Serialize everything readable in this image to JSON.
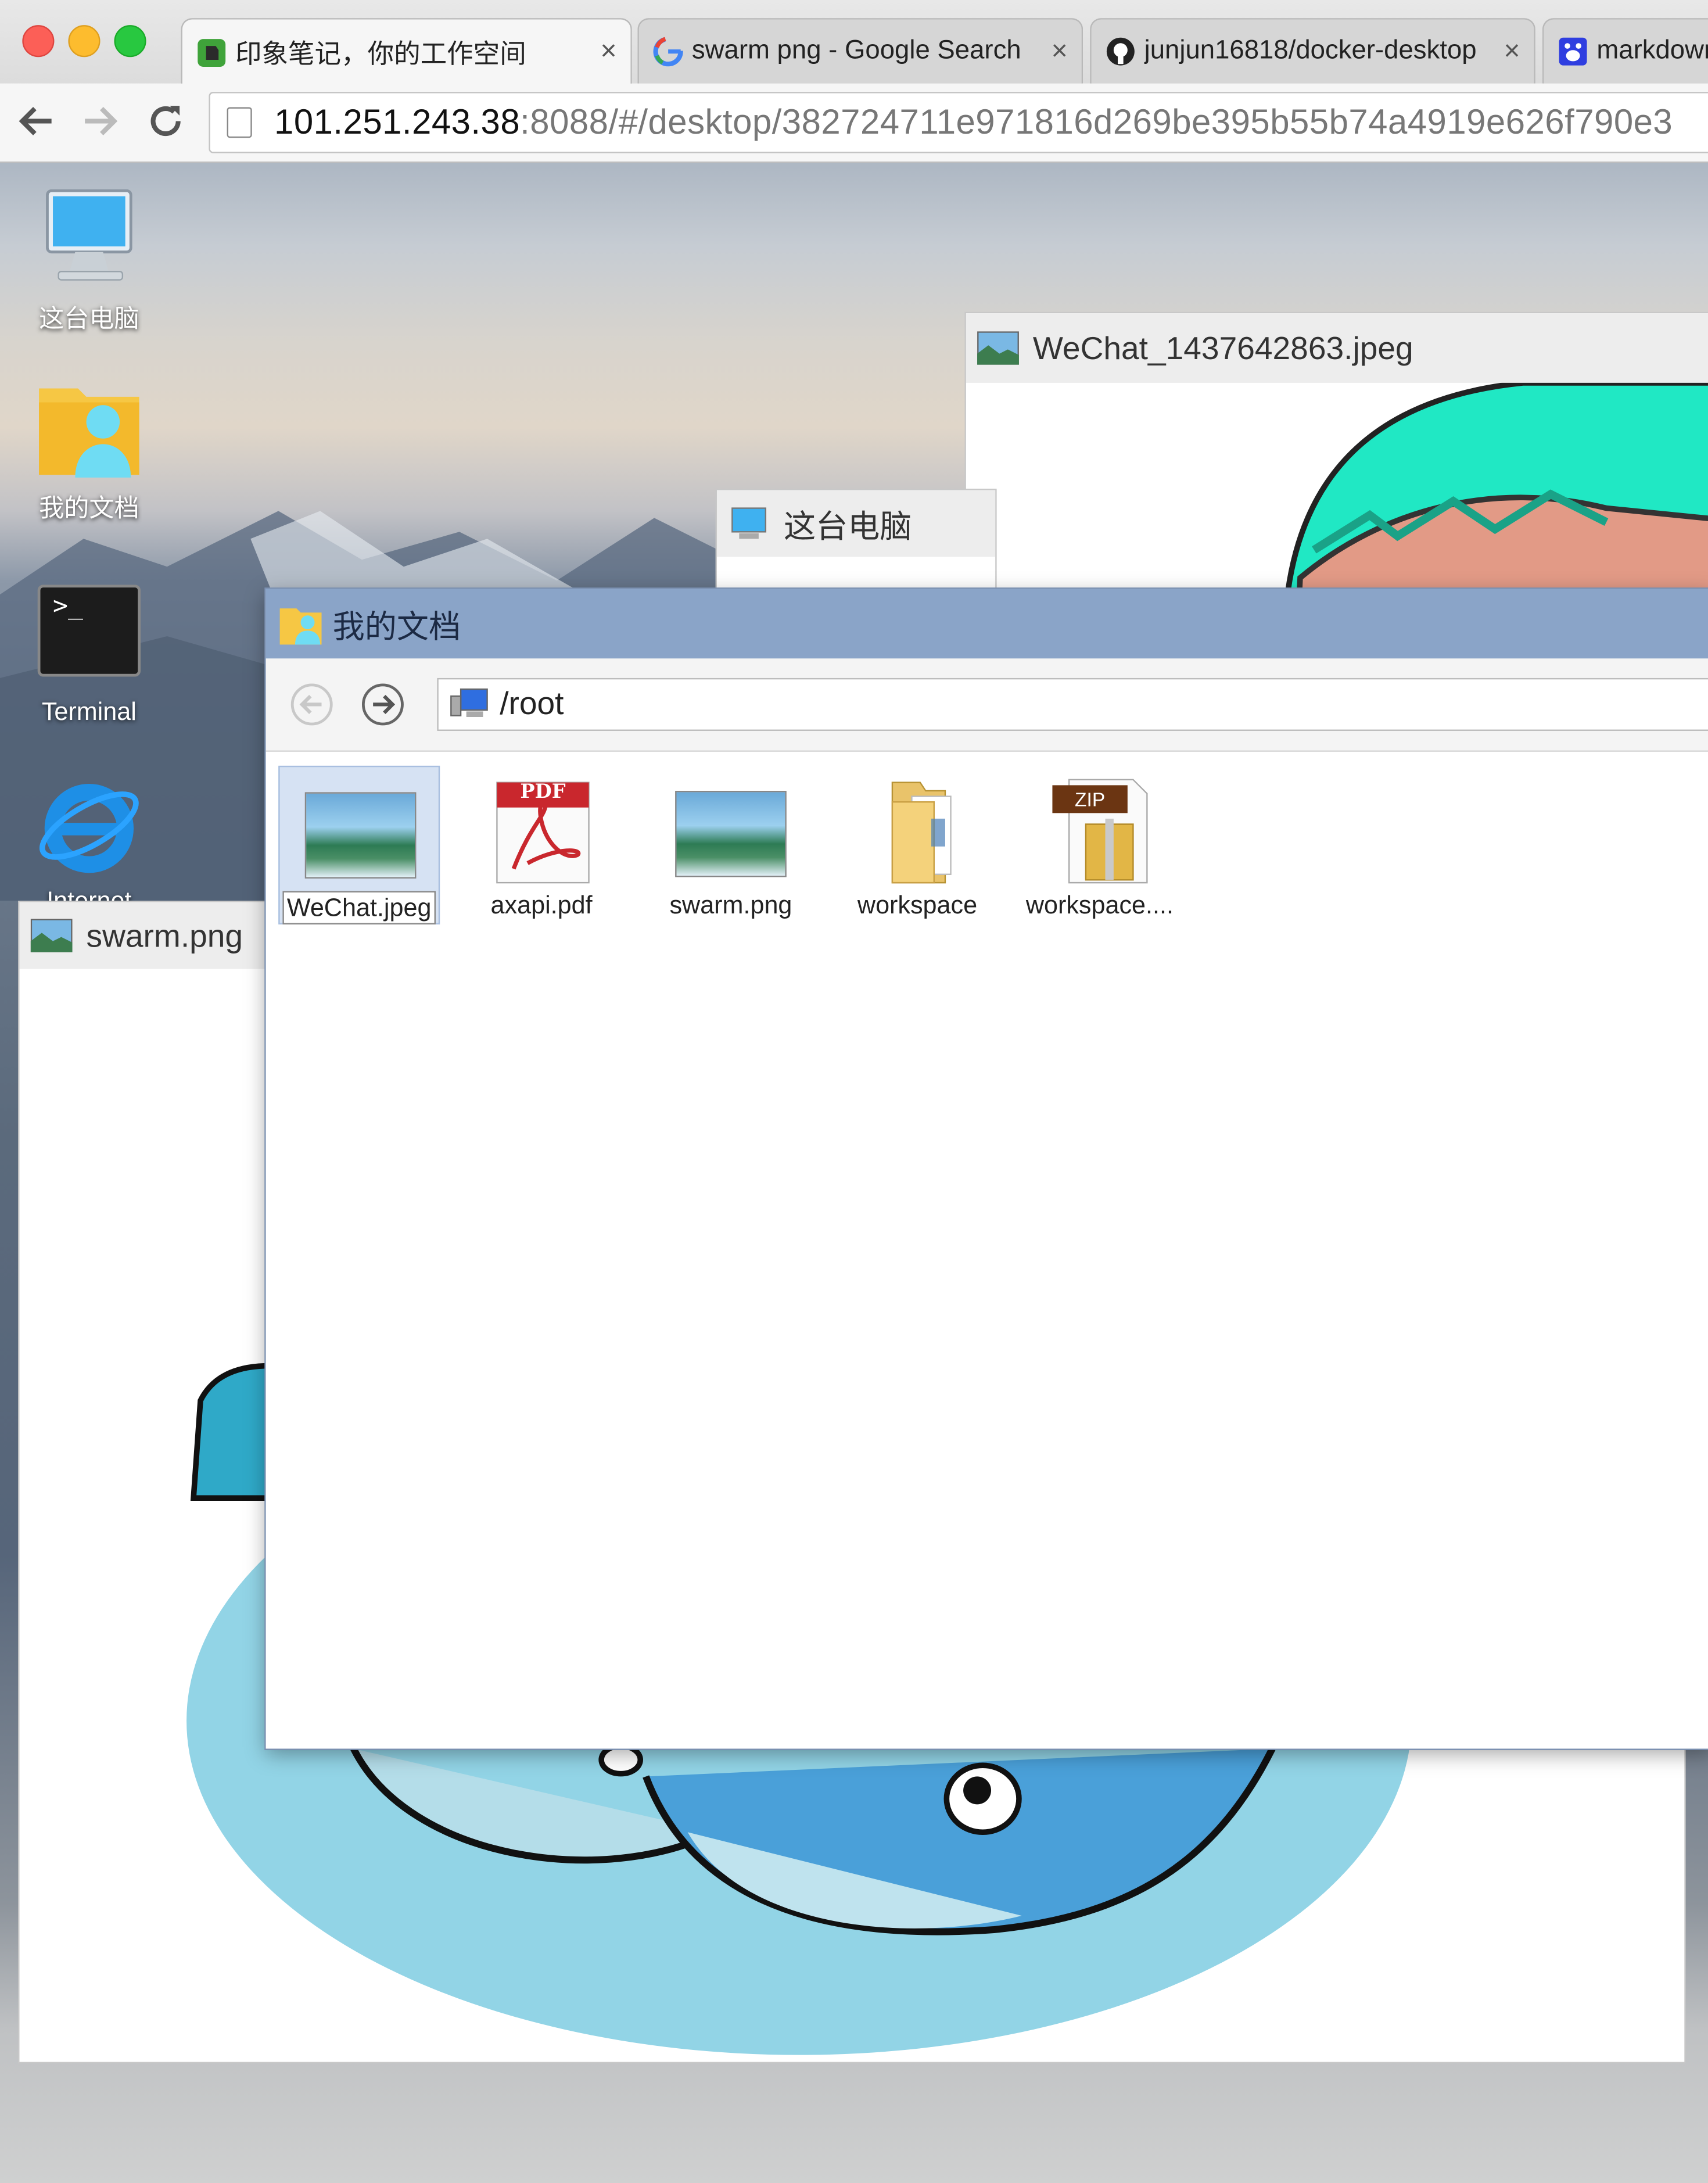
{
  "browser": {
    "tabs": [
      {
        "title": "印象笔记，你的工作空间",
        "icon": "evernote-icon",
        "active": true
      },
      {
        "title": "swarm png - Google Search",
        "icon": "google-icon",
        "active": false
      },
      {
        "title": "junjun16818/docker-desktop",
        "icon": "github-icon",
        "active": false
      },
      {
        "title": "markdown",
        "icon": "baidu-icon",
        "active": false
      }
    ],
    "tab_close_glyph": "×",
    "address": {
      "host": "101.251.243.38",
      "rest": ":8088/#/desktop/382724711e971816d269be395b55b74a4919e626f790e3"
    }
  },
  "desktop": {
    "icons": [
      {
        "label": "这台电脑",
        "icon": "computer-icon"
      },
      {
        "label": "我的文档",
        "icon": "user-folder-icon"
      },
      {
        "label": "Terminal",
        "icon": "terminal-icon"
      },
      {
        "label": "Internet",
        "icon": "internet-explorer-icon"
      }
    ],
    "terminal_prompt": ">_"
  },
  "windows": {
    "wechat_viewer": {
      "title": "WeChat_1437642863.jpeg"
    },
    "this_pc": {
      "title": "这台电脑"
    },
    "swarm_viewer": {
      "title": "swarm.png"
    },
    "file_manager": {
      "title": "我的文档",
      "path": "/root",
      "files": [
        {
          "name": "WeChat.jpeg",
          "type": "image",
          "selected": true
        },
        {
          "name": "axapi.pdf",
          "type": "pdf",
          "badge": "PDF"
        },
        {
          "name": "swarm.png",
          "type": "image"
        },
        {
          "name": "workspace",
          "type": "folder"
        },
        {
          "name": "workspace....",
          "type": "zip",
          "badge": "ZIP"
        }
      ]
    }
  }
}
